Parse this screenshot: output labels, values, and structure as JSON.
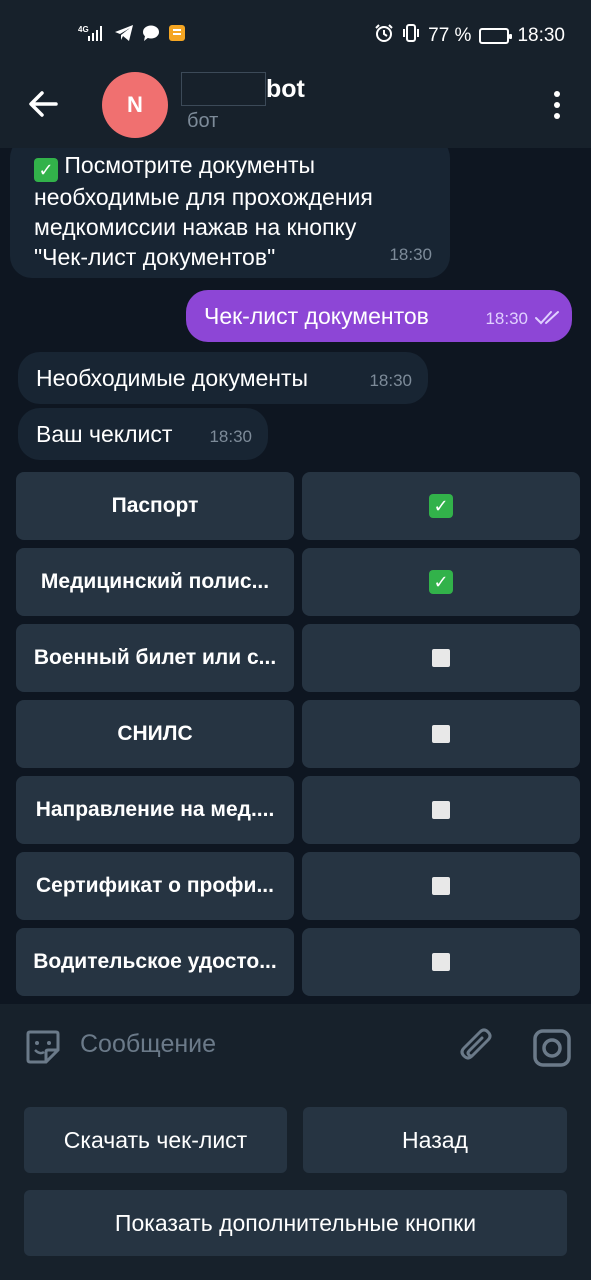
{
  "status_bar": {
    "signal_text": "4G",
    "battery": "77 %",
    "battery_level": 0.77,
    "time": "18:30"
  },
  "header": {
    "avatar_letter": "N",
    "avatar_color": "#f07070",
    "title": "bot",
    "subtitle": "бот"
  },
  "messages": [
    {
      "side": "in",
      "emoji": "✓",
      "text_lines": [
        "Посмотрите документы",
        "необходимые для прохождения",
        "медкомиссии нажав на кнопку",
        "\"Чек-лист документов\""
      ],
      "time": "18:30"
    },
    {
      "side": "out",
      "text": "Чек-лист документов",
      "time": "18:30"
    },
    {
      "side": "in",
      "text": "Необходимые документы",
      "time": "18:30"
    },
    {
      "side": "in",
      "text": "Ваш чеклист",
      "time": "18:30"
    }
  ],
  "checklist": [
    {
      "label": "Паспорт",
      "checked": true
    },
    {
      "label": "Медицинский полис...",
      "checked": true
    },
    {
      "label": "Военный билет или с...",
      "checked": false
    },
    {
      "label": "СНИЛС",
      "checked": false
    },
    {
      "label": "Направление на мед....",
      "checked": false
    },
    {
      "label": "Сертификат о профи...",
      "checked": false
    },
    {
      "label": "Водительское удосто...",
      "checked": false
    }
  ],
  "input": {
    "placeholder": "Сообщение"
  },
  "reply_keyboard": {
    "download": "Скачать чек-лист",
    "back": "Назад",
    "more": "Показать дополнительные кнопки"
  },
  "colors": {
    "accent_out": "#8d46d6",
    "check_green": "#32b24a",
    "bubble_in": "#182533",
    "chat_bg": "#0e1621"
  }
}
